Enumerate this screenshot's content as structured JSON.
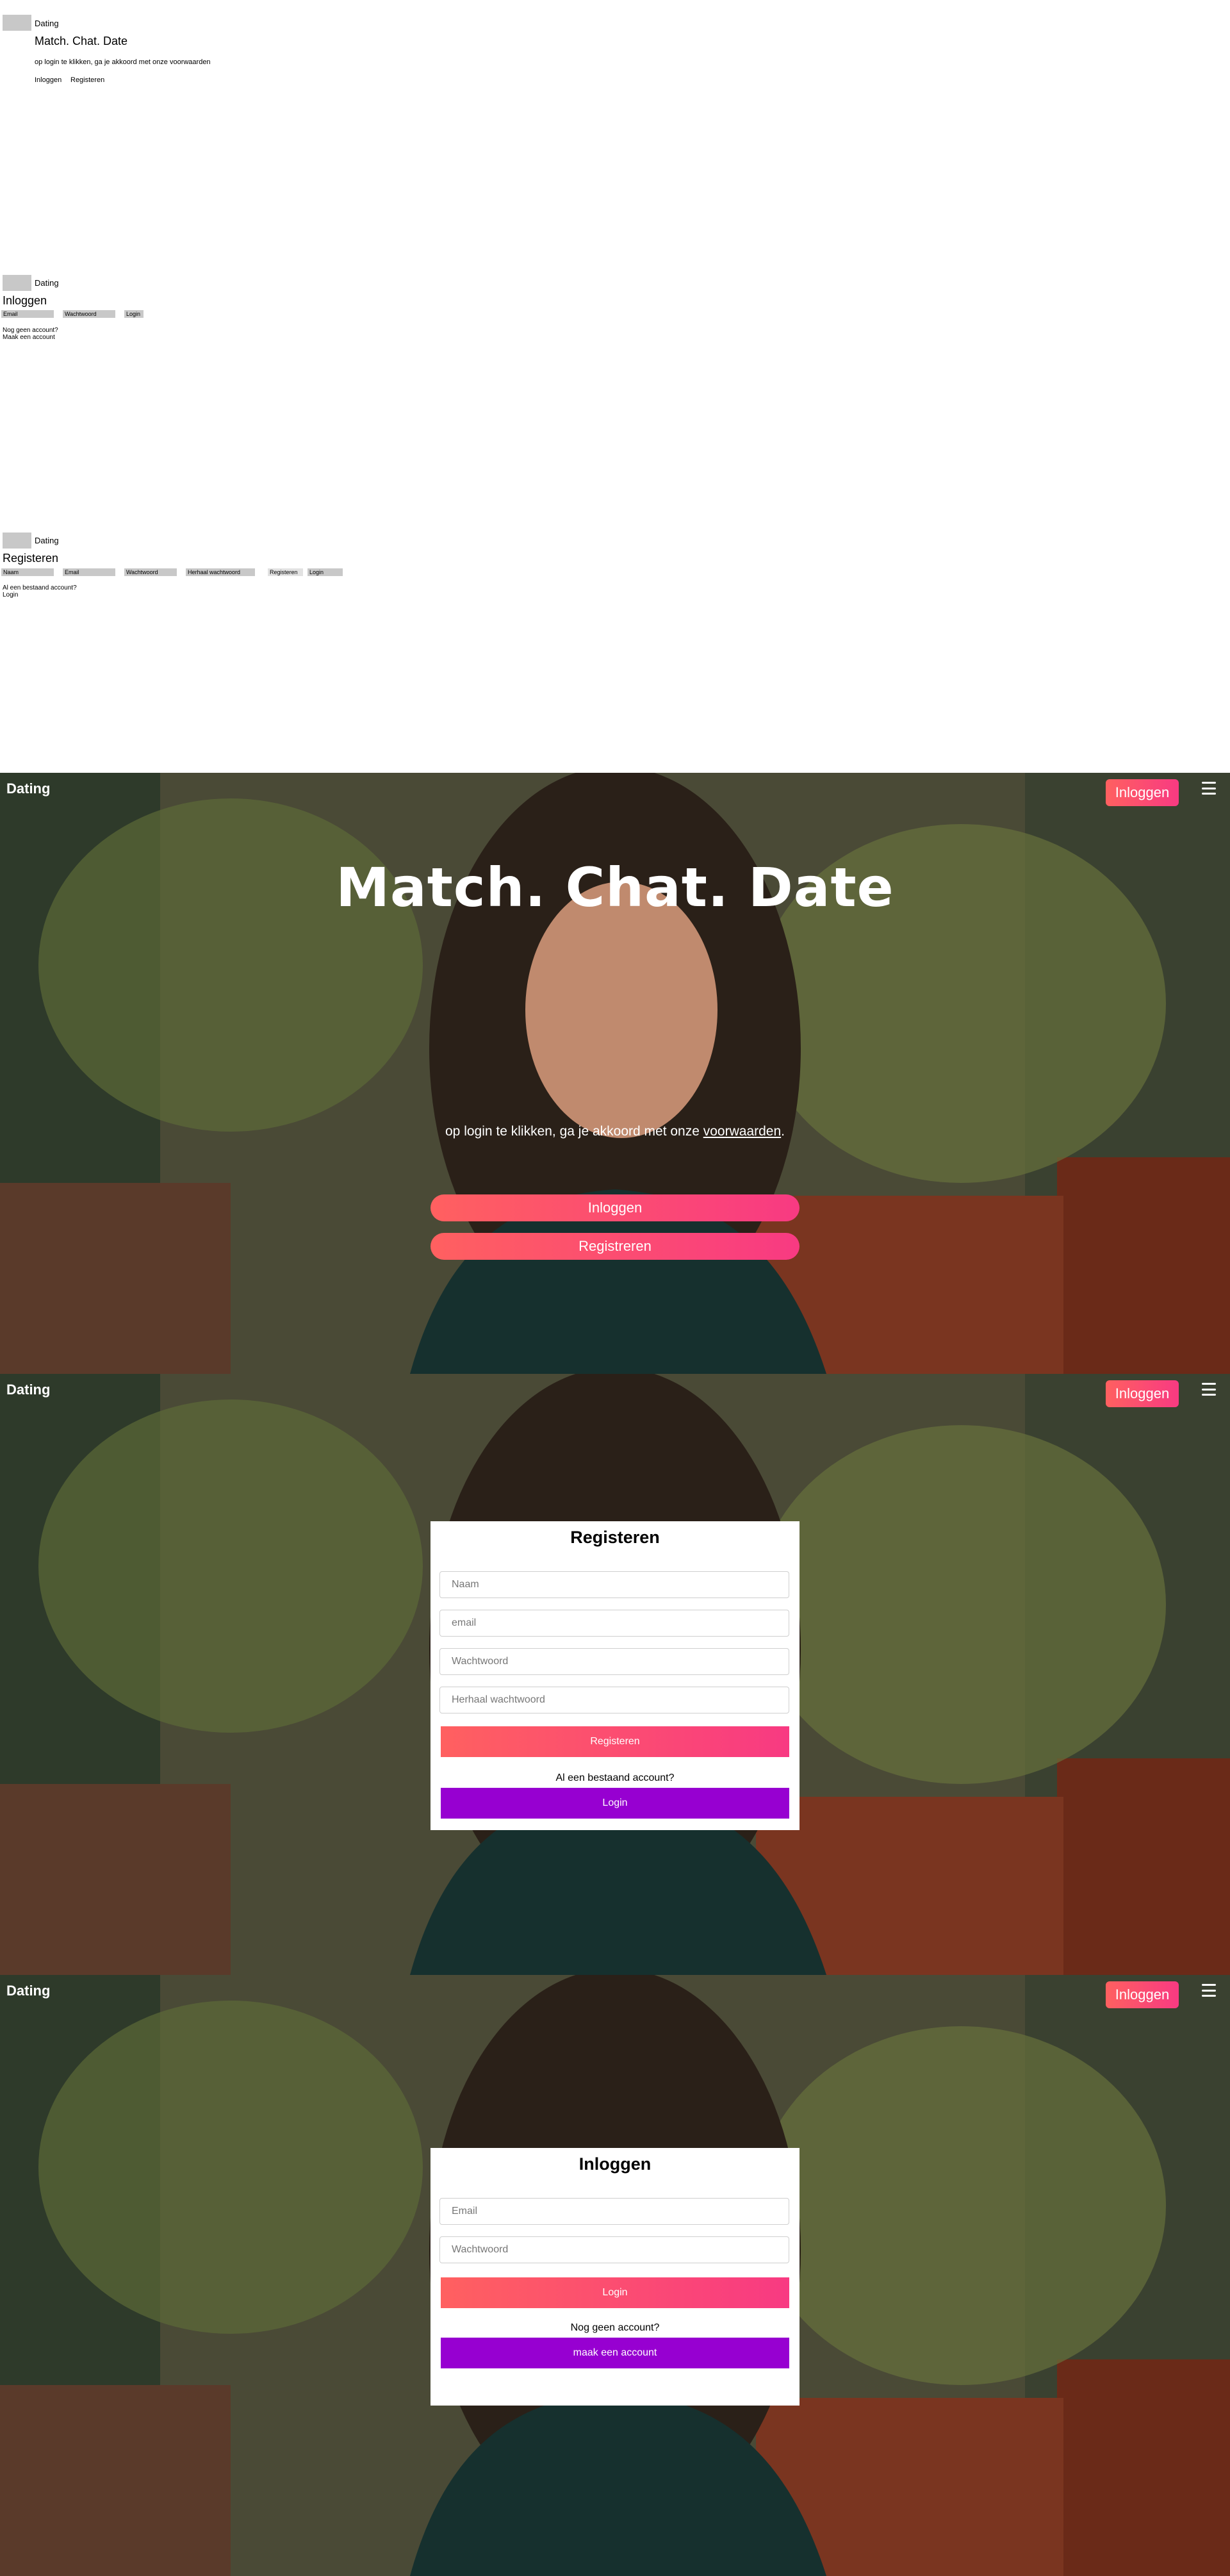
{
  "wireframe_home": {
    "brand": "Dating",
    "title": "Match. Chat. Date",
    "terms": "op login te klikken, ga je akkoord met onze voorwaarden",
    "login_link": "Inloggen",
    "register_link": "Registeren"
  },
  "wireframe_login": {
    "brand": "Dating",
    "title": "Inloggen",
    "email": "Email",
    "password": "Wachtwoord",
    "submit": "Login",
    "question": "Nog geen account?",
    "create": "Maak een account"
  },
  "wireframe_register": {
    "brand": "Dating",
    "title": "Registeren",
    "name": "Naam",
    "email": "Email",
    "password": "Wachtwoord",
    "repeat": "Herhaal wachtwoord",
    "submit": "Registeren",
    "login": "Login",
    "question": "Al een bestaand account?",
    "login_link": "Login"
  },
  "nav": {
    "brand": "Dating",
    "login_button": "Inloggen",
    "menu_icon": "hamburger-icon"
  },
  "home": {
    "title": "Match. Chat. Date",
    "terms_prefix": "op login te klikken, ga je akkoord met onze",
    "terms_link": "voorwaarden",
    "terms_suffix": ".",
    "login_button": "Inloggen",
    "register_button": "Registreren"
  },
  "register_form": {
    "title": "Registeren",
    "name_placeholder": "Naam",
    "email_placeholder": "email",
    "password_placeholder": "Wachtwoord",
    "repeat_placeholder": "Herhaal wachtwoord",
    "submit": "Registeren",
    "question": "Al een bestaand account?",
    "login_button": "Login"
  },
  "login_form": {
    "title": "Inloggen",
    "email_placeholder": "Email",
    "password_placeholder": "Wachtwoord",
    "submit": "Login",
    "question": "Nog geen account?",
    "create_button": "maak een account"
  },
  "colors": {
    "gradient_start": "#ff6060",
    "gradient_end": "#f83a82",
    "purple": "#9700d1"
  }
}
